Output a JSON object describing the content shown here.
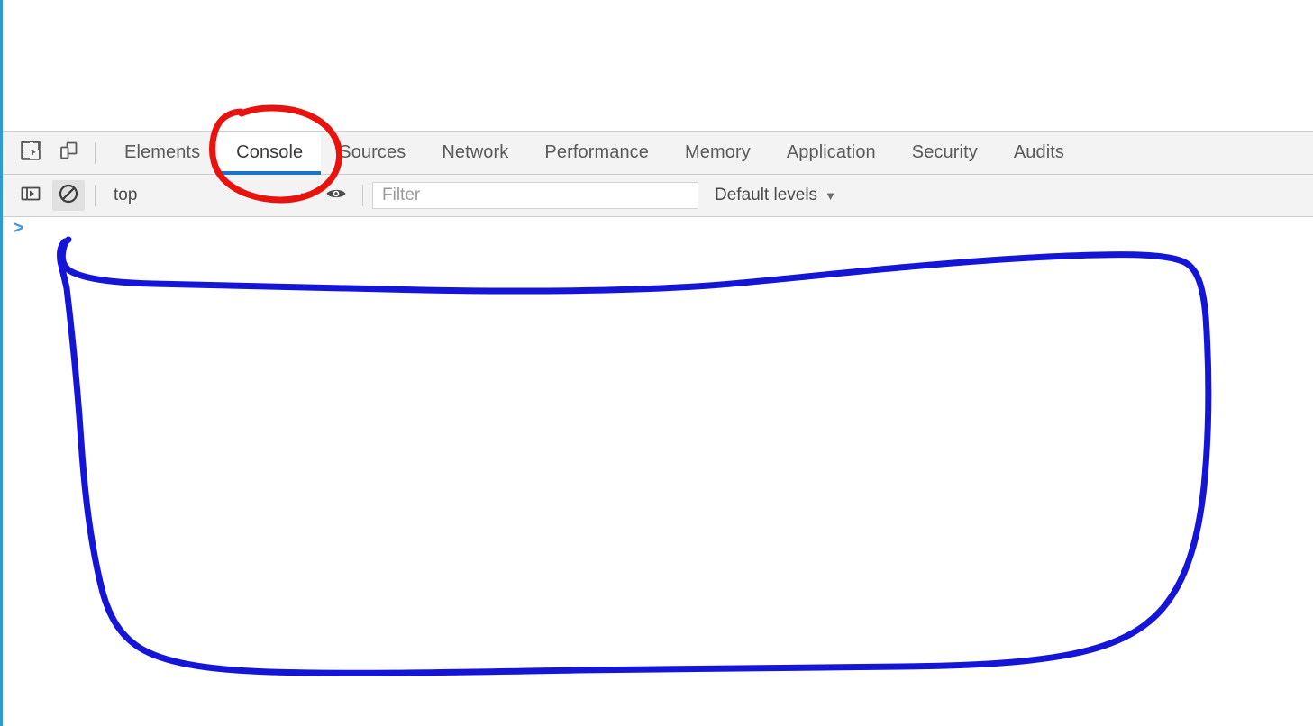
{
  "window": {
    "app": "Chrome DevTools",
    "accent_blue": "#1a73c8",
    "panel_bg": "#f3f3f3",
    "page_edge_color": "#2e9bd6"
  },
  "toolbar": {
    "icons": [
      {
        "name": "inspect-element-icon",
        "title": "Inspect element"
      },
      {
        "name": "device-toolbar-icon",
        "title": "Toggle device toolbar"
      }
    ]
  },
  "tabs": {
    "active": "Console",
    "items": [
      {
        "label": "Elements",
        "active": false
      },
      {
        "label": "Console",
        "active": true
      },
      {
        "label": "Sources",
        "active": false
      },
      {
        "label": "Network",
        "active": false
      },
      {
        "label": "Performance",
        "active": false
      },
      {
        "label": "Memory",
        "active": false
      },
      {
        "label": "Application",
        "active": false
      },
      {
        "label": "Security",
        "active": false
      },
      {
        "label": "Audits",
        "active": false
      }
    ]
  },
  "console_toolbar": {
    "sidebar_toggle": {
      "name": "console-sidebar-icon",
      "title": "Show console sidebar"
    },
    "clear_console": {
      "name": "clear-console-icon",
      "title": "Clear console"
    },
    "context": {
      "value": "top",
      "caret": "▼"
    },
    "live_expression": {
      "name": "eye-icon",
      "title": "Create live expression"
    },
    "filter": {
      "value": "",
      "placeholder": "Filter"
    },
    "levels": {
      "label": "Default levels",
      "caret": "▼"
    }
  },
  "console": {
    "prompt": ">",
    "messages": []
  },
  "annotations": {
    "red": {
      "name": "red-circle-highlight",
      "color": "#e8120f",
      "target": "Console",
      "stroke_width": 7
    },
    "blue": {
      "name": "blue-rounded-rect-highlight",
      "color": "#1515d8",
      "target": "console output area",
      "stroke_width": 7
    }
  }
}
